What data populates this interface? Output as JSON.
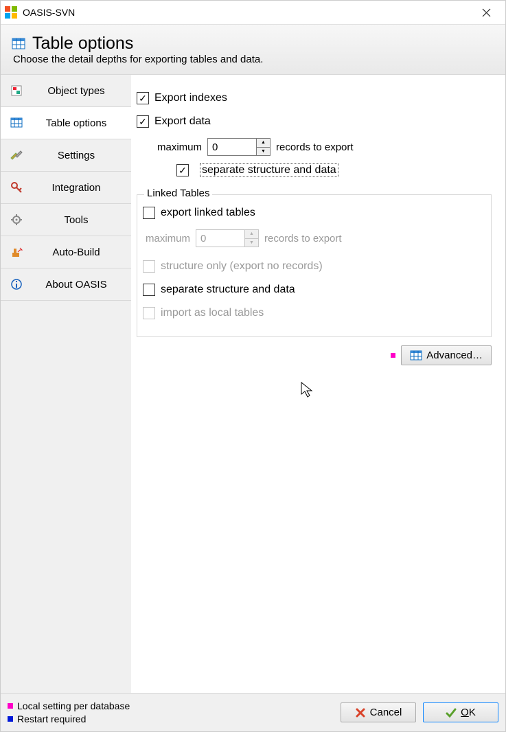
{
  "window": {
    "title": "OASIS-SVN"
  },
  "header": {
    "title": "Table options",
    "subtitle": "Choose the detail depths for exporting tables and data."
  },
  "sidebar": {
    "items": [
      {
        "label": "Object types"
      },
      {
        "label": "Table options"
      },
      {
        "label": "Settings"
      },
      {
        "label": "Integration"
      },
      {
        "label": "Tools"
      },
      {
        "label": "Auto-Build"
      },
      {
        "label": "About OASIS"
      }
    ]
  },
  "options": {
    "export_indexes": {
      "label": "Export indexes",
      "checked": true
    },
    "export_data": {
      "label": "Export data",
      "checked": true,
      "max_label": "maximum",
      "max_value": "0",
      "max_suffix": "records to export",
      "separate": {
        "label": "separate structure and data",
        "checked": true
      }
    },
    "linked": {
      "legend": "Linked Tables",
      "export_linked": {
        "label": "export linked tables",
        "checked": false
      },
      "max_label": "maximum",
      "max_value": "0",
      "max_suffix": "records to export",
      "structure_only": {
        "label": "structure only (export no records)",
        "checked": false
      },
      "separate": {
        "label": "separate structure and data",
        "checked": false
      },
      "import_local": {
        "label": "import as local tables",
        "checked": false
      }
    },
    "advanced_label": "Advanced…"
  },
  "footer": {
    "legend_magenta": "Local setting per database",
    "legend_blue": "Restart required",
    "cancel": "Cancel",
    "ok": "OK"
  }
}
